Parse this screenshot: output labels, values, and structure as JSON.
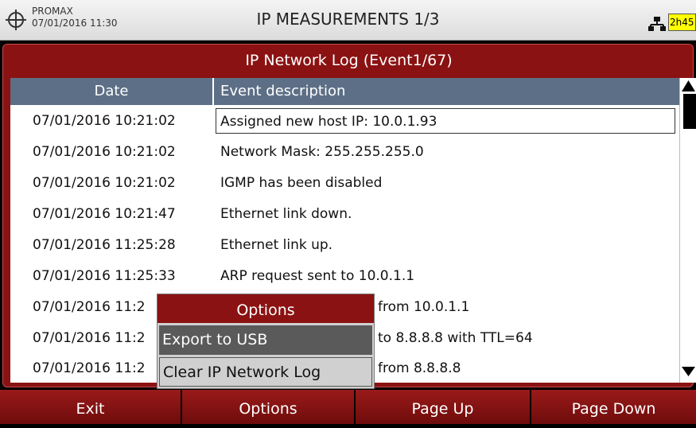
{
  "statusbar": {
    "brand": "PROMAX",
    "datetime": "07/01/2016 11:30",
    "title": "IP MEASUREMENTS 1/3",
    "battery_text": "2h45"
  },
  "panel": {
    "title": "IP Network Log (Event1/67)",
    "columns": {
      "date": "Date",
      "description": "Event description"
    },
    "rows": [
      {
        "date": "07/01/2016 10:21:02",
        "desc": "Assigned new host IP: 10.0.1.93"
      },
      {
        "date": "07/01/2016 10:21:02",
        "desc": "Network Mask: 255.255.255.0"
      },
      {
        "date": "07/01/2016 10:21:02",
        "desc": "IGMP has been disabled"
      },
      {
        "date": "07/01/2016 10:21:47",
        "desc": "Ethernet link down."
      },
      {
        "date": "07/01/2016 11:25:28",
        "desc": "Ethernet link up."
      },
      {
        "date": "07/01/2016 11:25:33",
        "desc": "ARP request sent to 10.0.1.1"
      },
      {
        "date": "07/01/2016 11:2",
        "desc": "from 10.0.1.1"
      },
      {
        "date": "07/01/2016 11:2",
        "desc": "to 8.8.8.8 with TTL=64"
      },
      {
        "date": "07/01/2016 11:2",
        "desc": "from 8.8.8.8"
      }
    ]
  },
  "popup": {
    "title": "Options",
    "items": [
      "Export to USB",
      "Clear IP Network Log"
    ]
  },
  "softkeys": [
    "Exit",
    "Options",
    "Page Up",
    "Page Down"
  ],
  "colors": {
    "header_red": "#8b1212",
    "table_header": "#5c6f86",
    "battery": "#ffff00"
  }
}
